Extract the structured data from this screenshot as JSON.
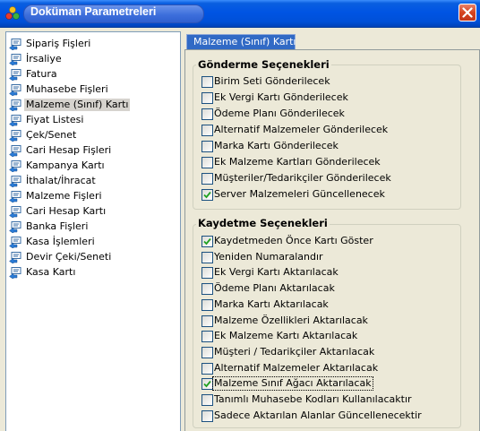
{
  "window": {
    "title": "Doküman Parametreleri"
  },
  "nav": {
    "items": [
      {
        "label": "Sipariş Fişleri"
      },
      {
        "label": "İrsaliye"
      },
      {
        "label": "Fatura"
      },
      {
        "label": "Muhasebe Fişleri"
      },
      {
        "label": "Malzeme (Sınıf) Kartı"
      },
      {
        "label": "Fiyat Listesi"
      },
      {
        "label": "Çek/Senet"
      },
      {
        "label": "Cari Hesap Fişleri"
      },
      {
        "label": "Kampanya Kartı"
      },
      {
        "label": "İthalat/İhracat"
      },
      {
        "label": "Malzeme Fişleri"
      },
      {
        "label": "Cari Hesap Kartı"
      },
      {
        "label": "Banka Fişleri"
      },
      {
        "label": "Kasa İşlemleri"
      },
      {
        "label": "Devir Çeki/Seneti"
      },
      {
        "label": "Kasa Kartı"
      }
    ],
    "selected": "Malzeme (Sınıf) Kartı"
  },
  "tab": {
    "label": "Malzeme (Sınıf) Kartı"
  },
  "send_group": {
    "title": "Gönderme Seçenekleri",
    "options": [
      {
        "label": "Birim Seti Gönderilecek",
        "checked": false
      },
      {
        "label": "Ek Vergi Kartı Gönderilecek",
        "checked": false
      },
      {
        "label": "Ödeme Planı Gönderilecek",
        "checked": false
      },
      {
        "label": "Alternatif Malzemeler Gönderilecek",
        "checked": false
      },
      {
        "label": "Marka Kartı Gönderilecek",
        "checked": false
      },
      {
        "label": "Ek Malzeme Kartları Gönderilecek",
        "checked": false
      },
      {
        "label": "Müşteriler/Tedarikçiler Gönderilecek",
        "checked": false
      },
      {
        "label": "Server Malzemeleri Güncellenecek",
        "checked": true
      }
    ]
  },
  "save_group": {
    "title": "Kaydetme Seçenekleri",
    "options": [
      {
        "label": "Kaydetmeden Önce Kartı Göster",
        "checked": true
      },
      {
        "label": "Yeniden Numaralandır",
        "checked": false
      },
      {
        "label": "Ek Vergi Kartı Aktarılacak",
        "checked": false
      },
      {
        "label": "Ödeme Planı Aktarılacak",
        "checked": false
      },
      {
        "label": "Marka Kartı Aktarılacak",
        "checked": false
      },
      {
        "label": "Malzeme Özellikleri Aktarılacak",
        "checked": false
      },
      {
        "label": "Ek Malzeme Kartı Aktarılacak",
        "checked": false
      },
      {
        "label": "Müşteri / Tedarikçiler Aktarılacak",
        "checked": false
      },
      {
        "label": "Alternatif Malzemeler Aktarılacak",
        "checked": false
      },
      {
        "label": "Malzeme Sınıf Ağacı Aktarılacak",
        "checked": true
      },
      {
        "label": "Tanımlı Muhasebe Kodları Kullanılacaktır",
        "checked": false
      },
      {
        "label": "Sadece Aktarılan Alanlar Güncellenecektir",
        "checked": false
      }
    ]
  },
  "colors": {
    "titlebar": "#0054e3",
    "selection": "#316ac5",
    "check": "#21a121"
  }
}
